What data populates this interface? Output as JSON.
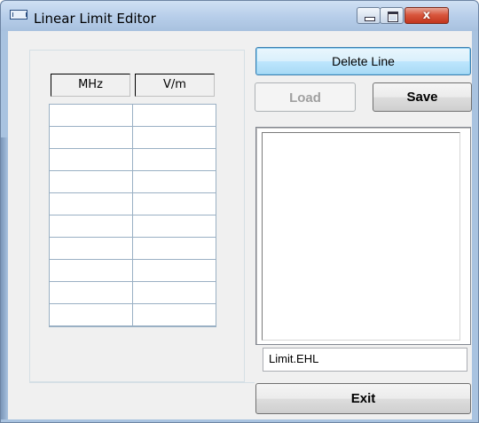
{
  "window": {
    "title": "Linear Limit Editor"
  },
  "caption_buttons": {
    "close_glyph": "x"
  },
  "table": {
    "headers": [
      "MHz",
      "V/m"
    ],
    "rows": [
      [
        "",
        ""
      ],
      [
        "",
        ""
      ],
      [
        "",
        ""
      ],
      [
        "",
        ""
      ],
      [
        "",
        ""
      ],
      [
        "",
        ""
      ],
      [
        "",
        ""
      ],
      [
        "",
        ""
      ],
      [
        "",
        ""
      ],
      [
        "",
        ""
      ]
    ]
  },
  "buttons": {
    "delete_line": "Delete Line",
    "load": "Load",
    "save": "Save",
    "exit": "Exit"
  },
  "load_enabled": false,
  "file_list": [],
  "filename_value": "Limit.EHL"
}
